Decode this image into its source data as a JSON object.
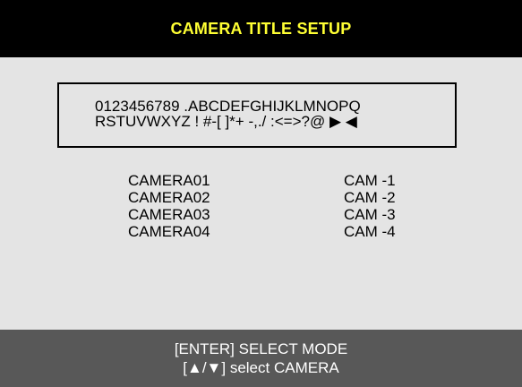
{
  "header": {
    "title": "CAMERA TITLE SETUP"
  },
  "charset": {
    "line1": "0123456789 .ABCDEFGHIJKLMNOPQ",
    "line2": "RSTUVWXYZ ! #-[ ]*+ -,./ :<=>?@ ▶ ◀"
  },
  "cameras": [
    {
      "name": "CAMERA01",
      "alias": "CAM -1"
    },
    {
      "name": "CAMERA02",
      "alias": "CAM -2"
    },
    {
      "name": "CAMERA03",
      "alias": "CAM -3"
    },
    {
      "name": "CAMERA04",
      "alias": "CAM -4"
    }
  ],
  "footer": {
    "line1": "[ENTER] SELECT MODE",
    "line2": "[▲/▼] select CAMERA"
  },
  "colors": {
    "header_bg": "#000000",
    "title": "#ffff33",
    "body_bg": "#e4e4e4",
    "footer_bg": "#585858",
    "footer_text": "#ffffff"
  }
}
